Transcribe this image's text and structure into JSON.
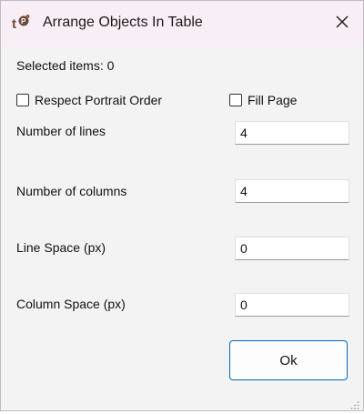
{
  "window": {
    "title": "Arrange Objects In Table",
    "app_icon": "tp-logo-icon",
    "close_icon": "close-icon"
  },
  "form": {
    "selected_items": "Selected items: 0",
    "respect_portrait_order": {
      "label": "Respect Portrait Order",
      "checked": false
    },
    "fill_page": {
      "label": "Fill Page",
      "checked": false
    },
    "number_of_lines": {
      "label": "Number of lines",
      "value": "4"
    },
    "number_of_columns": {
      "label": "Number of columns",
      "value": "4"
    },
    "line_space": {
      "label": "Line Space (px)",
      "value": "0"
    },
    "column_space": {
      "label": "Column Space (px)",
      "value": "0"
    }
  },
  "buttons": {
    "ok_label": "Ok"
  },
  "colors": {
    "titlebar_bg": "#f8eff6",
    "dialog_bg": "#f3f3f3",
    "accent_border": "#0067c0"
  }
}
